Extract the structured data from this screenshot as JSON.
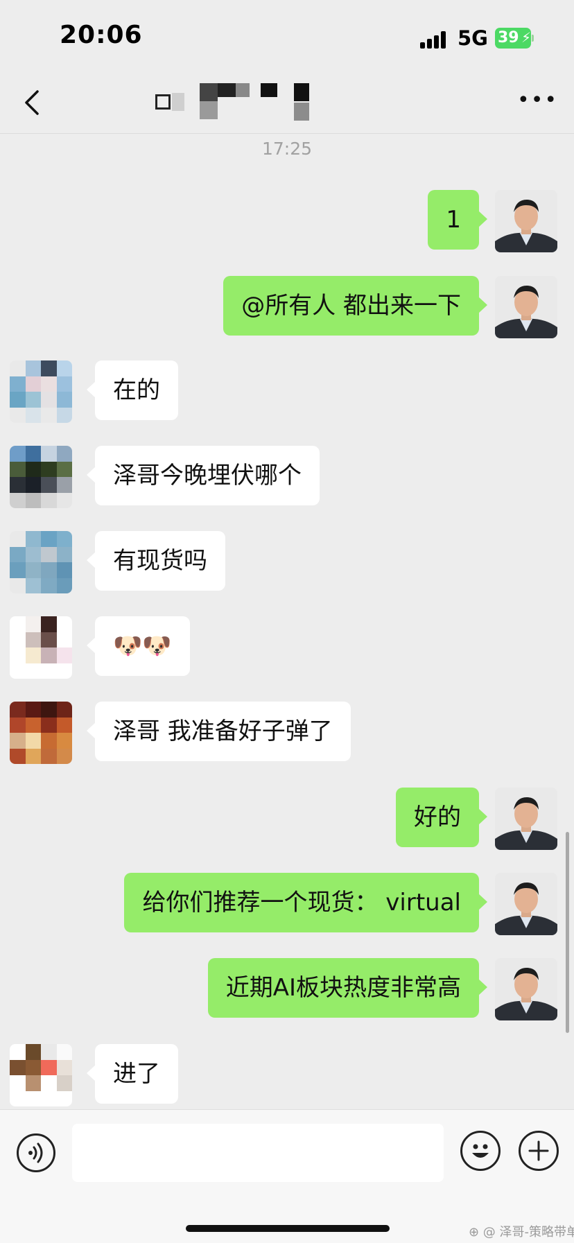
{
  "status_bar": {
    "time": "20:06",
    "network": "5G",
    "battery": "39",
    "battery_color": "#4cd964"
  },
  "nav": {
    "back_icon": "chevron-left-icon",
    "more_icon": "more-dots-icon",
    "more_label": "•••"
  },
  "chat": {
    "timestamp": "17:25",
    "messages": [
      {
        "side": "right",
        "text": "1"
      },
      {
        "side": "right",
        "text": "@所有人 都出来一下"
      },
      {
        "side": "left",
        "text": "在的"
      },
      {
        "side": "left",
        "text": "泽哥今晚埋伏哪个"
      },
      {
        "side": "left",
        "text": "有现货吗"
      },
      {
        "side": "left",
        "text": "🐶🐶"
      },
      {
        "side": "left",
        "text": "泽哥 我准备好子弹了"
      },
      {
        "side": "right",
        "text": "好的"
      },
      {
        "side": "right",
        "text": "给你们推荐一个现货： virtual"
      },
      {
        "side": "right",
        "text": "近期AI板块热度非常高"
      },
      {
        "side": "left",
        "text": "进了"
      }
    ]
  },
  "input_bar": {
    "voice_icon": "voice-icon",
    "emoji_icon": "emoji-icon",
    "plus_icon": "plus-icon"
  },
  "watermark": "⊕ @ 泽哥-策略带单",
  "colors": {
    "background": "#ededed",
    "sent_bubble": "#95ec69",
    "received_bubble": "#ffffff"
  }
}
